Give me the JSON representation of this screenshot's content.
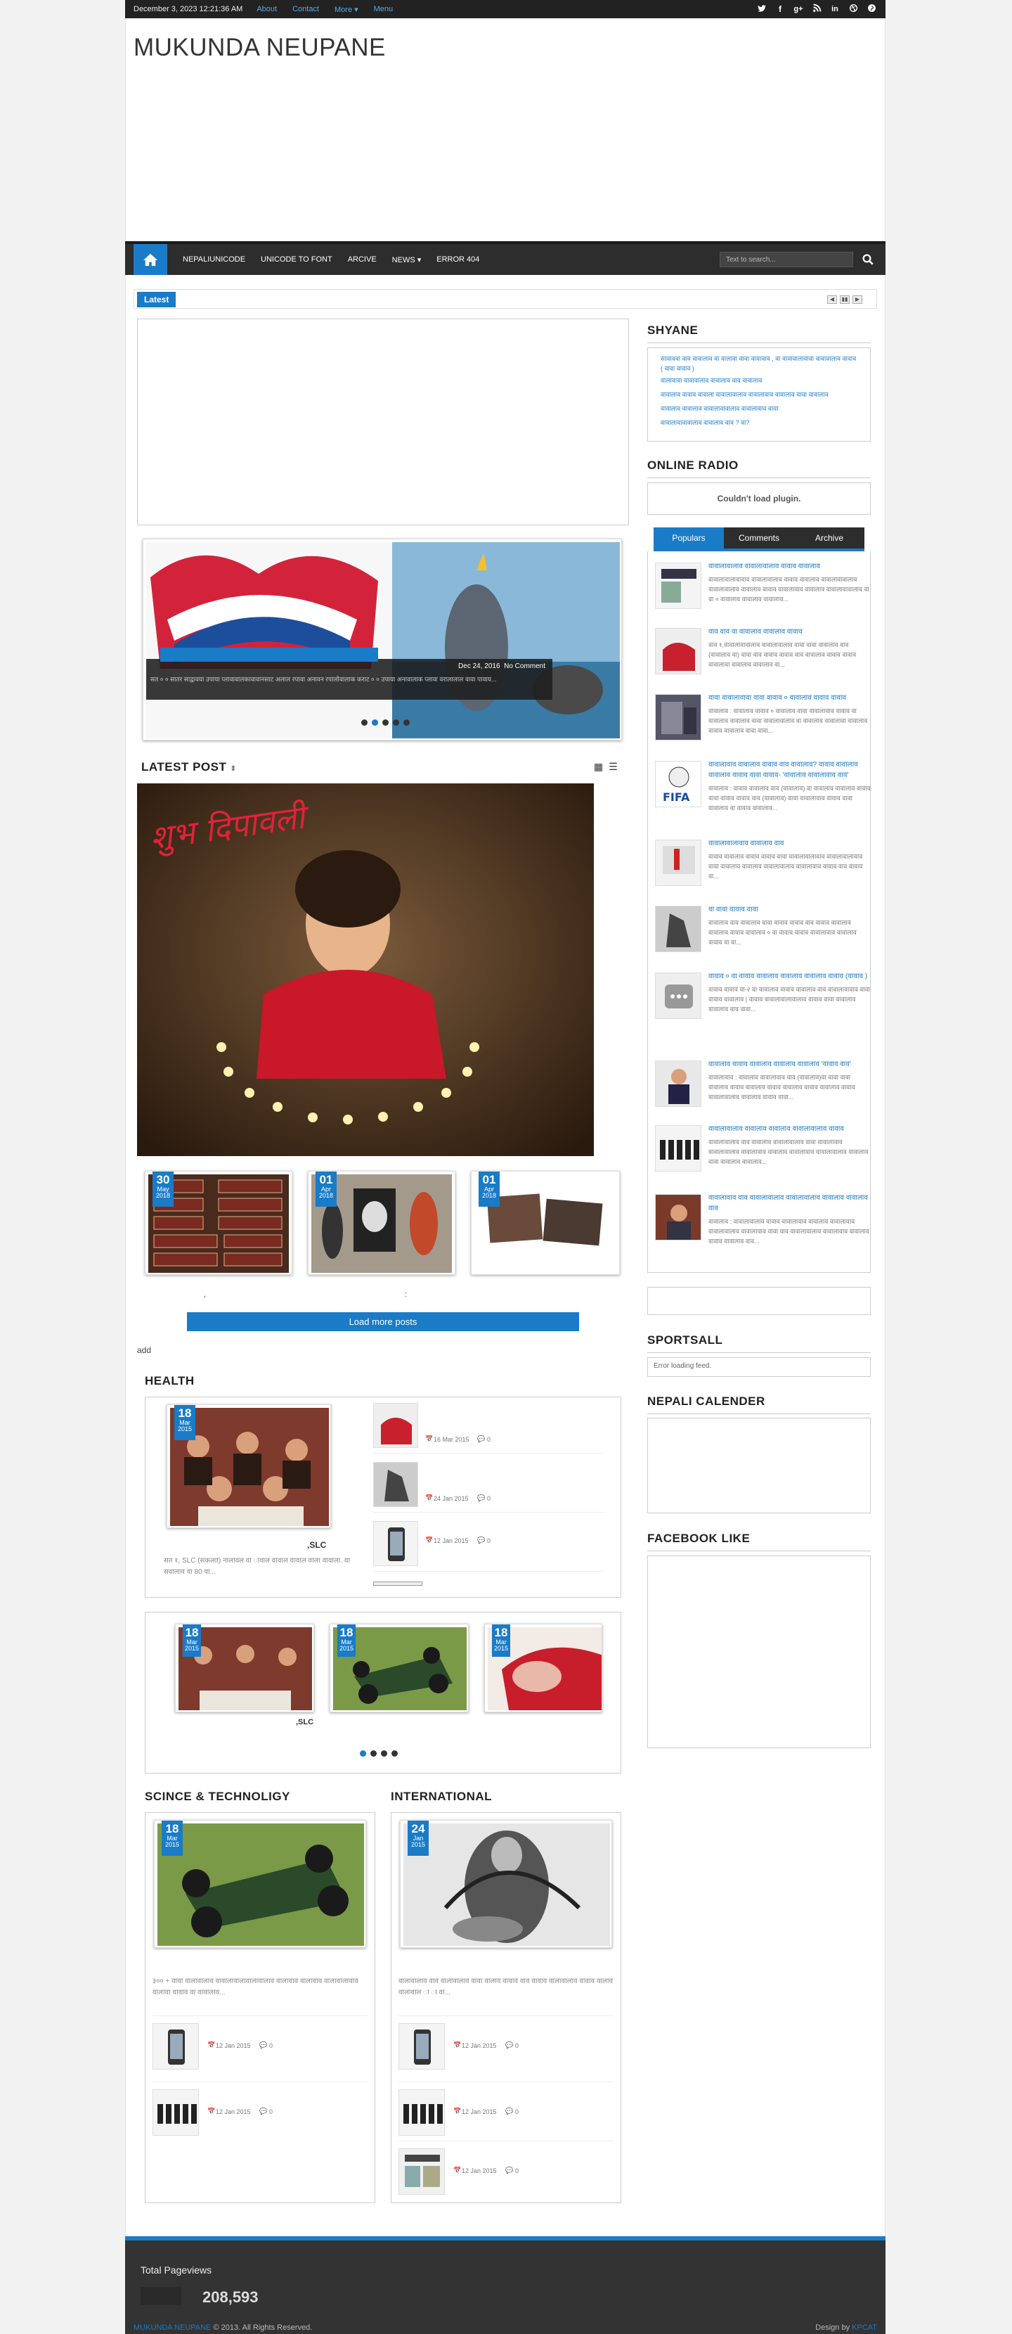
{
  "topbar": {
    "date": "December 3, 2023 12:21:36 AM",
    "links": [
      "About",
      "Contact",
      "More ▾",
      "Menu"
    ],
    "social": [
      "twitter-icon",
      "facebook-icon",
      "google-plus-icon",
      "rss-icon",
      "linkedin-icon",
      "dribbble-icon",
      "pinterest-icon"
    ]
  },
  "site": {
    "title": "MUKUNDA NEUPANE"
  },
  "nav": {
    "items": [
      "NEPALIUNICODE",
      "UNICODE TO FONT",
      "ARCIVE",
      "NEWS ▾",
      "ERROR 404"
    ],
    "search_placeholder": "Text to search..."
  },
  "ticker": {
    "label": "Latest"
  },
  "slider": {
    "meta_date": "Dec 24, 2016",
    "meta_comment": "No Comment",
    "caption": "सत ० ० सातर साद्वावया उपाया प्लावावालकावावानसाट अलाल रपावा अनावन रपालोवालाक कराट ० ० उपाया अनावालाक प्लावा वरालालाल वावा पावाय..."
  },
  "latest_post": {
    "title": "LATEST POST",
    "cards": [
      {
        "day": "30",
        "mon": "May",
        "year": "2018"
      },
      {
        "day": "01",
        "mon": "Apr",
        "year": "2018"
      },
      {
        "day": "01",
        "mon": "Apr",
        "year": "2018"
      }
    ],
    "load_more": "Load more posts",
    "add": "add"
  },
  "health": {
    "title": "HEALTH",
    "main_day": "18",
    "main_mon": "Mar",
    "main_year": "2015",
    "main_title": ",SLC",
    "main_text": "सत १, SLC (सकलाा) नालावल वा ावाल वावाल वावाल वाला वावाला. वा सवालाव वा 80 वा...",
    "list": [
      {
        "date": "16 Mar 2015",
        "comments": "0"
      },
      {
        "date": "24 Jan 2015",
        "comments": "0"
      },
      {
        "date": "12 Jan 2015",
        "comments": "0"
      }
    ],
    "carousel": [
      {
        "day": "18",
        "mon": "Mar",
        "year": "2015"
      },
      {
        "day": "18",
        "mon": "Mar",
        "year": "2015"
      },
      {
        "day": "18",
        "mon": "Mar",
        "year": "2015"
      }
    ],
    "carousel_title": ",SLC"
  },
  "science": {
    "title": "SCINCE & TECHNOLIGY",
    "day": "18",
    "mon": "Mar",
    "year": "2015",
    "text": "३०० + वावा वालावालाव वावालावालावालावालाव वालावाव वालावाव वालावालावाव वालावा वावाव वा वावालाव...",
    "list": [
      {
        "date": "12 Jan 2015",
        "comments": "0"
      },
      {
        "date": "12 Jan 2015",
        "comments": "0"
      }
    ]
  },
  "international": {
    "title": "INTERNATIONAL",
    "day": "24",
    "mon": "Jan",
    "year": "2015",
    "text": "वालावालाव वाव वालावालाव वावा वालाव वावाव वाव वावाव वालावालाव वावाव वालाव वालावाल ा ा वा...",
    "list": [
      {
        "date": "12 Jan 2015",
        "comments": "0"
      },
      {
        "date": "12 Jan 2015",
        "comments": "0"
      },
      {
        "date": "12 Jan 2015",
        "comments": "0"
      }
    ]
  },
  "sidebar": {
    "shyane": {
      "title": "SHYANE",
      "links": [
        "सावाववा वाव वावालाव वा वालावा वावा वावावाव , वा वावावालावावा वावावालाव वावाव ( वावा वावाव )",
        "वालावावा वावावालाव वावालाव वाव वावालाव",
        "वावालाव वावाव वावाला वावालावालाव वावालावाव वावालाव वावा वावालाव",
        "वावालाव वावालाव वावालावावालाव वावालावाव वावा",
        "वावालावावावालाव वावालाव वाव ? वा?"
      ]
    },
    "radio": {
      "title": "ONLINE RADIO",
      "msg": "Couldn't load plugin."
    },
    "tabs": [
      "Populars",
      "Comments",
      "Archive"
    ],
    "populars": [
      {
        "title": "वावालावालाव वावालावालाव वावाव वावालाव",
        "text": "वावालावालावावाव वावालावालाव वावाव वावालाव वावालावावालाव वावालावालाव वावालाव वावाव वावालावाव वावालाव वावालावावालाव वा वा ० वावालाव वावालाव वावालाव..."
      },
      {
        "title": "वाव वाव वा वावालाव वावालाव वावाव",
        "text": "वाव १,वावालावावालाव वावालावालाव वावा वावा वावालाव वाव (वावालाव वा) वावा वाव वावाव वावाव वाव वावालाव वावाव वावाव वावालावा वावालाव वावालाव वा..."
      },
      {
        "title": "वावा वावालावावा वावा वावाव ० वावालाव वावाव वावाव",
        "text": "वावालाव : वावालाव वावाव ० वावालाव वावा वावालावाव वावाव वा वावालाव वावालाव वावा वावालावालाव वा वावालाव वावालावा वावालाव वावाव वावालाव वावा वावा..."
      },
      {
        "title": "वावालावाव वावालाव वावाव वाव वावालाव? वावाव वावालाव वावालाव वावाव वावा वावाव- 'वावालाव वावालावाव वाव'",
        "text": "वावालाव : वावाव वावालाव वाव (वावालाव) वा वावालाव वावालाव वावाव वावा वावाव वावाव वाव (वावालाव) वावा वावालावाव वावाव वावा वावालाव वा वावाव वावालाव..."
      },
      {
        "title": "वावालावालावाव वावालाव वाव",
        "text": "वावाव वावालाव वावाव वावाव वावा वावालावालावाव वावालावालावाव वावा वावालाव वावालाव वावालावालाव वावालावाव वावाव वाव वावाव वा..."
      },
      {
        "title": "वा वावा वावाव वावा",
        "text": "वावालाव वाव वावालाव वावा वावाव वावाव वाव वावाव वावालाव वावालाव वावाव वावालाव ० वा वावाव वावाव वावालावाव वावालाव वावाव वा वा..."
      },
      {
        "title": "वावाव ० वा वावाव वावालाव वावालाव वावालाव वावाव (वावाव )",
        "text": "वावाव वावाव वा-२ वा वावालाव वावाव वावालाव वाव वावालावावाव वावा वावाव वावालाव | वावाव वावालावालावालाव वावाव वावा वावालाव वावालाव वाव वावा..."
      },
      {
        "title": "वावालाव वावाव वावालाव वावालाव वावालाव 'वावाव वाव'",
        "text": "वावालावाव : वावालाव वावालावाव वाव (वावालाव)वा वावा वावा वावालाव वावाव वावालाव वावाव वावालाव वावाव वावालाव वावाव वावालावालाव वावालाव वावाव वावा..."
      },
      {
        "title": "वावालावालाव वावालाव वावालाव वावालावालाव वावाव",
        "text": "वावालावालाव वाव वावालाव वावालावालाव वावा वावालावाव वावालावालाव वावालावाव वावालाव वावालावाव वावालावालाव वावालाव वावा वावालाव वावालाव..."
      },
      {
        "title": "वावालावाव वाव वावालावालाव वावालावालाव वावालाव वावालाव वाव",
        "text": "वावालाव : वावालावालाव वावाव वावालावाव वावालाव वावालावाव वावालावालाव वावालावाव वावा वाव वावालावालाव वावालावाव वावालाव वावाव वावालाव वाव..."
      }
    ],
    "sportsall": {
      "title": "SPORTSALL",
      "msg": "Error loading feed."
    },
    "calendar": {
      "title": "NEPALI CALENDER"
    },
    "facebook": {
      "title": "FACEBOOK LIKE"
    }
  },
  "footer": {
    "pageviews_label": "Total Pageviews",
    "pageviews": "208,593",
    "copyright_name": "MUKUNDA NEUPANE",
    "copyright_rest": " © 2013. All Rights Reserved.",
    "design_by": "Design by ",
    "designer": "KPCAT"
  }
}
